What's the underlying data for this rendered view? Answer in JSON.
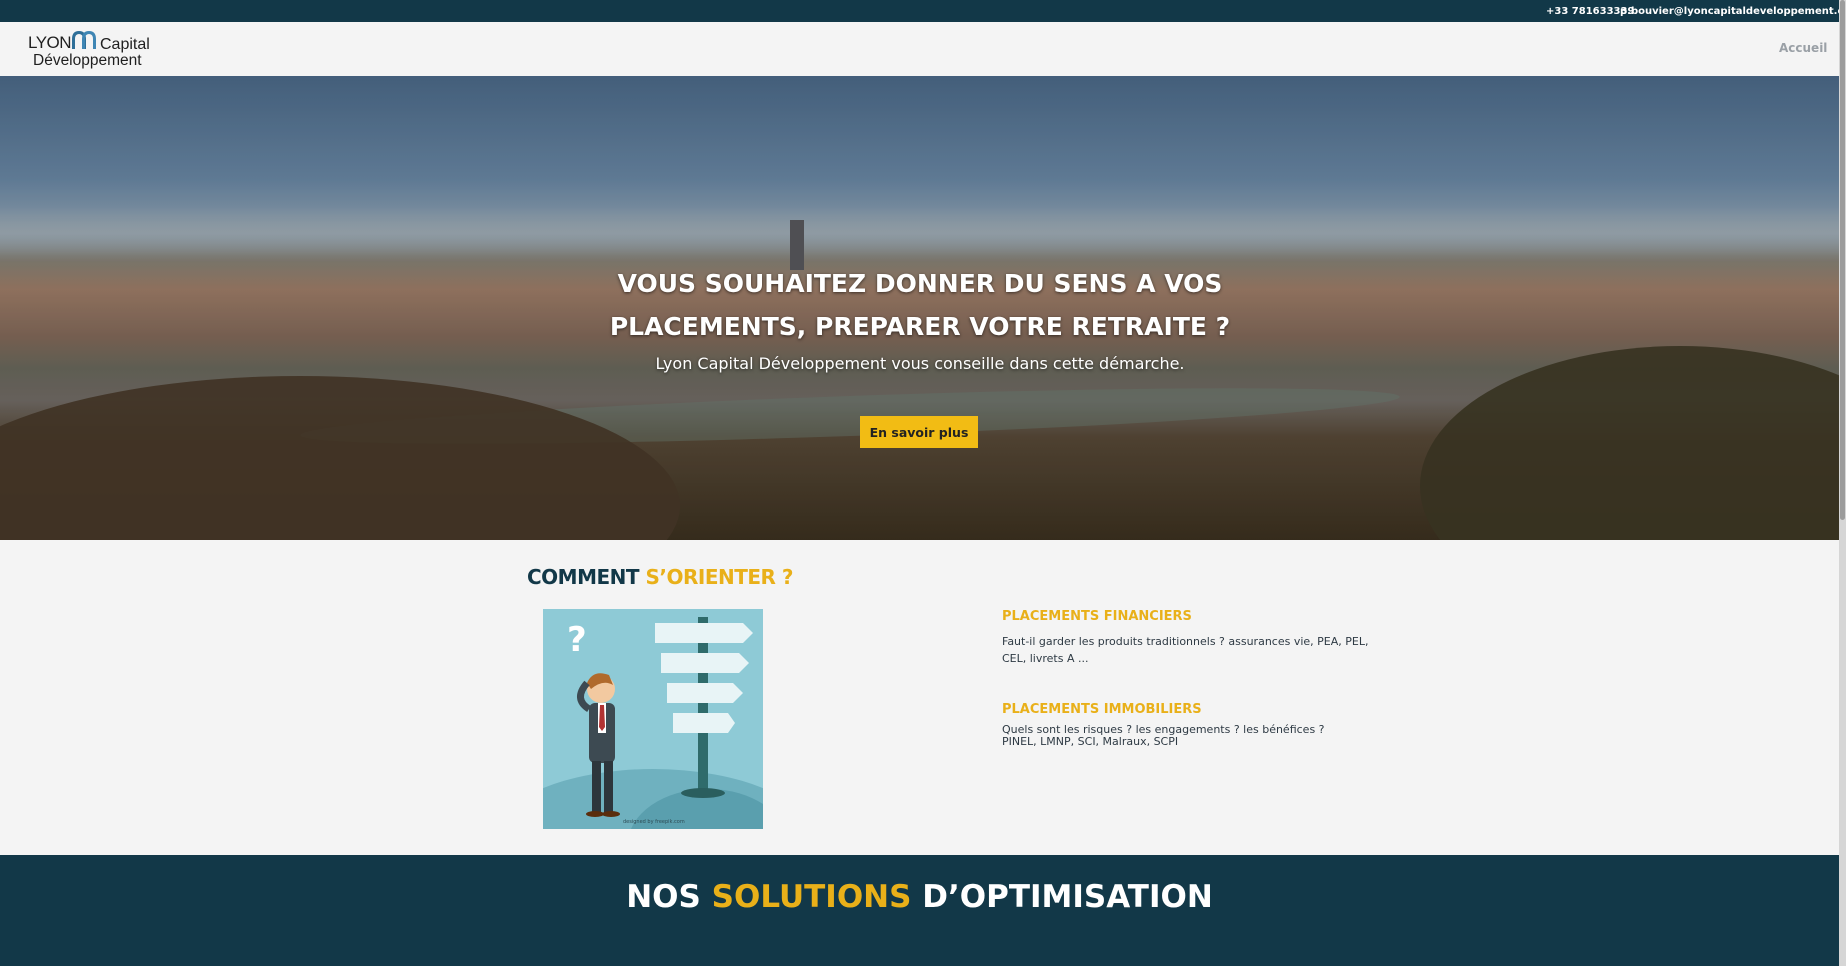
{
  "topbar": {
    "phone": "+33 781633339",
    "email": "p.bouvier@lyoncapitaldeveloppement.com"
  },
  "header": {
    "logo_word1": "LYON",
    "logo_word2": "Capital",
    "logo_word3": "Développement",
    "nav_home": "Accueil"
  },
  "hero": {
    "title_line1": "VOUS SOUHAITEZ DONNER DU SENS A VOS",
    "title_line2": "PLACEMENTS, PREPARER VOTRE RETRAITE ?",
    "subtitle": "Lyon Capital Développement vous conseille dans cette démarche.",
    "cta_label": "En savoir plus"
  },
  "orient": {
    "title_part1": "COMMENT ",
    "title_part2": "S’ORIENTER ?",
    "illustration_credit": "designed by freepik.com",
    "blocks": [
      {
        "title": "PLACEMENTS FINANCIERS",
        "text": "Faut-il garder les produits traditionnels ? assurances vie, PEA, PEL, CEL, livrets A ..."
      },
      {
        "title": "PLACEMENTS IMMOBILIERS",
        "text_line1": "Quels sont les risques ? les engagements ? les bénéfices ?",
        "text_line2": "PINEL, LMNP, SCI, Malraux, SCPI"
      }
    ]
  },
  "solutions": {
    "title_part1": "NOS ",
    "title_part2": "SOLUTIONS",
    "title_part3": " D’OPTIMISATION"
  },
  "colors": {
    "navy": "#123848",
    "accent_yellow": "#e9b019",
    "button_yellow": "#f2bc14",
    "background": "#f4f4f4"
  },
  "icons": [
    "logo-arch-icon",
    "question-mark-icon",
    "signpost-icon"
  ]
}
